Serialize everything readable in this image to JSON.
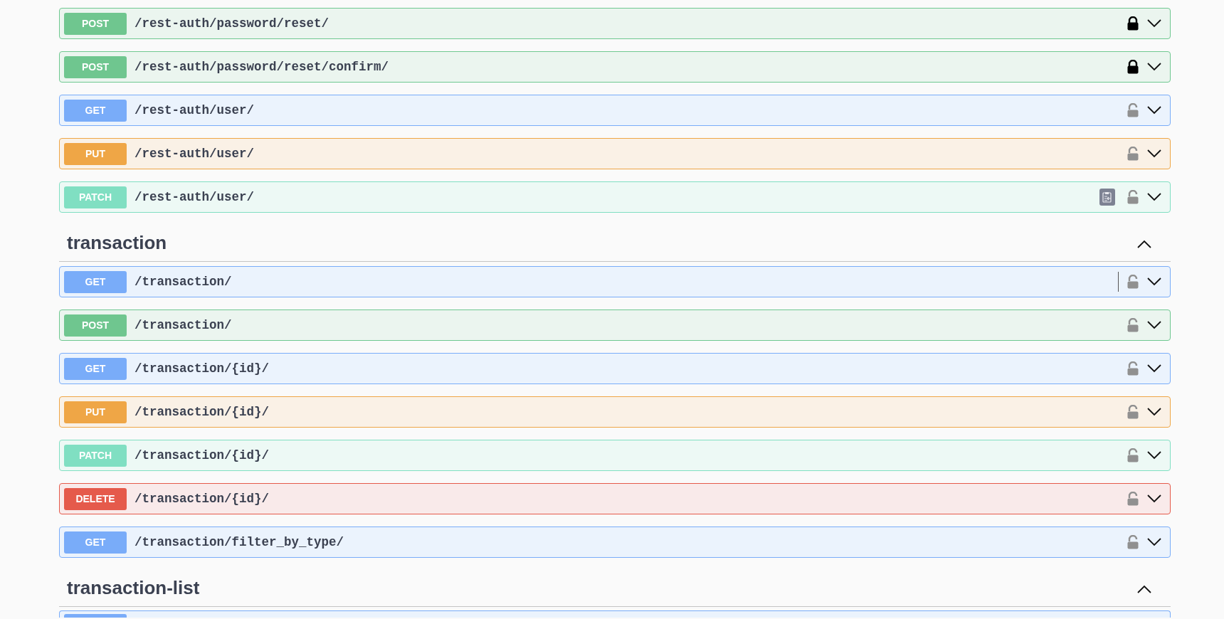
{
  "sections": [
    {
      "operations": [
        {
          "kind": "post",
          "method": "POST",
          "path": "/rest-auth/password/reset/",
          "locked": true
        },
        {
          "kind": "post",
          "method": "POST",
          "path": "/rest-auth/password/reset/confirm/",
          "locked": true
        },
        {
          "kind": "get",
          "method": "GET",
          "path": "/rest-auth/user/",
          "locked": false
        },
        {
          "kind": "put",
          "method": "PUT",
          "path": "/rest-auth/user/",
          "locked": false
        },
        {
          "kind": "patch",
          "method": "PATCH",
          "path": "/rest-auth/user/",
          "locked": false,
          "copy_button": true
        }
      ]
    },
    {
      "title": "transaction",
      "expanded": true,
      "operations": [
        {
          "kind": "get",
          "method": "GET",
          "path": "/transaction/",
          "locked": false,
          "divider": true
        },
        {
          "kind": "post",
          "method": "POST",
          "path": "/transaction/",
          "locked": false
        },
        {
          "kind": "get",
          "method": "GET",
          "path": "/transaction/{id}/",
          "locked": false
        },
        {
          "kind": "put",
          "method": "PUT",
          "path": "/transaction/{id}/",
          "locked": false
        },
        {
          "kind": "patch",
          "method": "PATCH",
          "path": "/transaction/{id}/",
          "locked": false
        },
        {
          "kind": "delete",
          "method": "DELETE",
          "path": "/transaction/{id}/",
          "locked": false
        },
        {
          "kind": "get",
          "method": "GET",
          "path": "/transaction/filter_by_type/",
          "locked": false
        }
      ]
    },
    {
      "title": "transaction-list",
      "expanded": true,
      "cut_off_row": true
    }
  ]
}
